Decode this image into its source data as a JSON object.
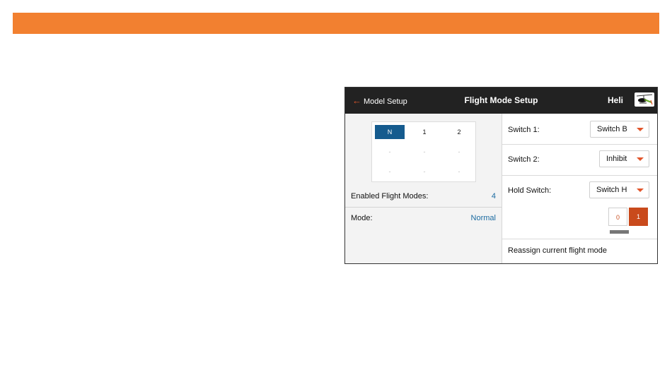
{
  "screen": {
    "back_label": "Model Setup",
    "title": "Flight Mode Setup",
    "model_name": "Heli",
    "model_icon": "helicopter-icon"
  },
  "mode_grid": {
    "headers": [
      "N",
      "1",
      "2"
    ],
    "selected": "N",
    "placeholder": "-"
  },
  "left": {
    "enabled_label": "Enabled Flight Modes:",
    "enabled_value": "4",
    "mode_label": "Mode:",
    "mode_value": "Normal"
  },
  "right": {
    "switch1_label": "Switch 1:",
    "switch1_value": "Switch B",
    "switch2_label": "Switch 2:",
    "switch2_value": "Inhibit",
    "hold_label": "Hold Switch:",
    "hold_value": "Switch H",
    "positions": [
      "0",
      "1"
    ],
    "active_position": "1",
    "reassign_label": "Reassign current flight mode"
  },
  "colors": {
    "header_bar": "#f28030",
    "topbar": "#222222",
    "accent": "#e2552b",
    "selected_mode": "#155b8e",
    "value_blue": "#1a6aa0"
  }
}
